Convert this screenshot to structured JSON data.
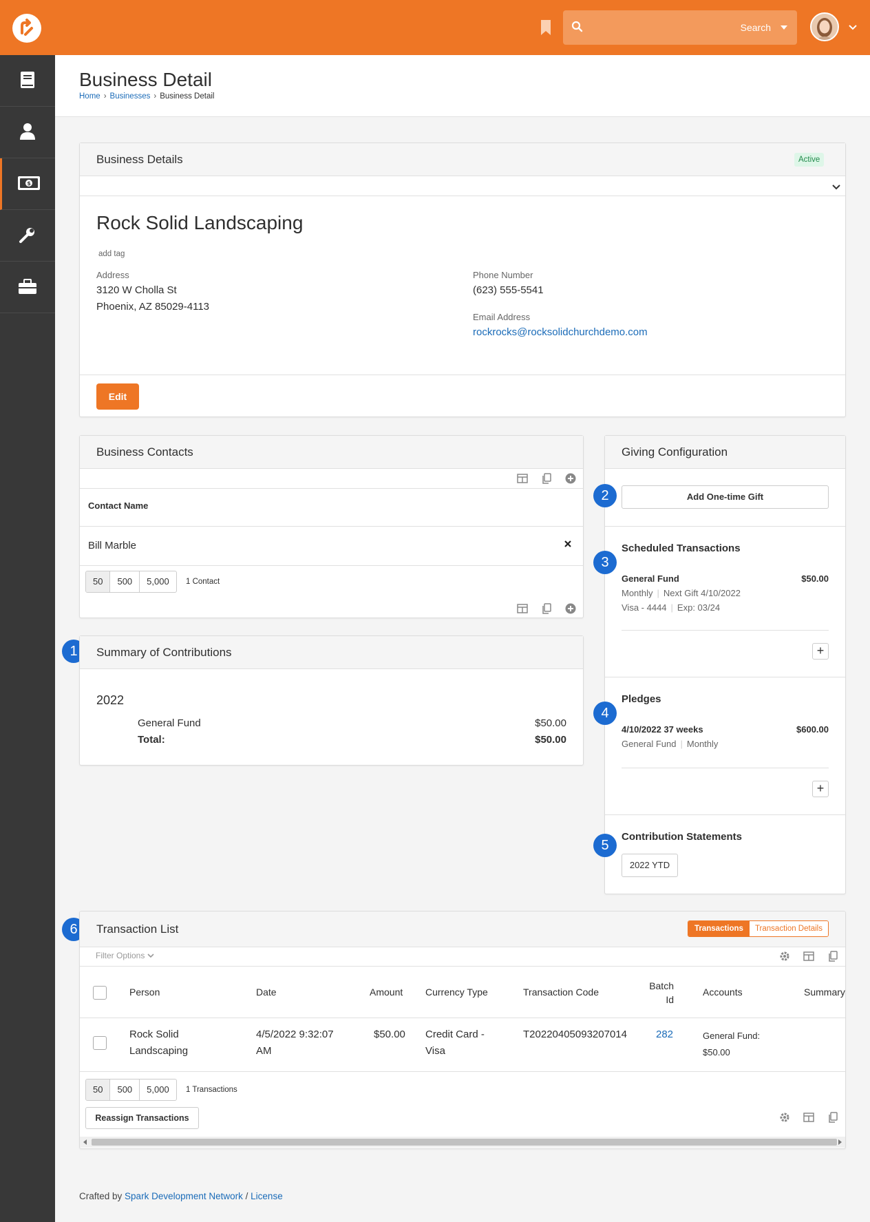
{
  "topbar": {
    "search_label": "Search",
    "colors": {
      "brand": "#ee7625",
      "link": "#1a6bb8",
      "sidebar": "#383838",
      "step": "#1c6bd1"
    }
  },
  "page": {
    "title": "Business Detail",
    "breadcrumb": [
      "Home",
      "Businesses",
      "Business Detail"
    ]
  },
  "details": {
    "panel_title": "Business Details",
    "status": "Active",
    "name": "Rock Solid Landscaping",
    "add_tag": "add tag",
    "address_label": "Address",
    "address_line1": "3120 W Cholla St",
    "address_line2": "Phoenix, AZ 85029-4113",
    "phone_label": "Phone Number",
    "phone": "(623) 555-5541",
    "email_label": "Email Address",
    "email": "rockrocks@rocksolidchurchdemo.com",
    "edit_label": "Edit"
  },
  "contacts": {
    "title": "Business Contacts",
    "column": "Contact Name",
    "rows": [
      "Bill Marble"
    ],
    "pager": [
      "50",
      "500",
      "5,000"
    ],
    "count": "1 Contact"
  },
  "summary": {
    "step": "1",
    "title": "Summary of Contributions",
    "year": "2022",
    "fund": "General Fund",
    "fund_amount": "$50.00",
    "total_label": "Total:",
    "total_amount": "$50.00"
  },
  "giving": {
    "title": "Giving Configuration",
    "step_gift": "2",
    "add_gift": "Add One-time Gift",
    "step_scheduled": "3",
    "scheduled_title": "Scheduled Transactions",
    "sched_fund": "General Fund",
    "sched_amount": "$50.00",
    "sched_freq": "Monthly",
    "sched_next": "Next Gift 4/10/2022",
    "sched_card": "Visa - 4444",
    "sched_exp": "Exp: 03/24",
    "step_pledges": "4",
    "pledges_title": "Pledges",
    "pledge_date": "4/10/2022 37 weeks",
    "pledge_amount": "$600.00",
    "pledge_fund": "General Fund",
    "pledge_freq": "Monthly",
    "step_statements": "5",
    "statements_title": "Contribution Statements",
    "statement_btn": "2022 YTD"
  },
  "transactions": {
    "step": "6",
    "title": "Transaction List",
    "toggle": [
      "Transactions",
      "Transaction Details"
    ],
    "filter": "Filter Options",
    "columns": [
      "Person",
      "Date",
      "Amount",
      "Currency Type",
      "Transaction Code",
      "Batch Id",
      "Accounts",
      "Summary"
    ],
    "row": {
      "person": "Rock Solid Landscaping",
      "date": "4/5/2022 9:32:07 AM",
      "amount": "$50.00",
      "currency": "Credit Card - Visa",
      "code": "T20220405093207014",
      "batch": "282",
      "accounts": "General Fund: $50.00"
    },
    "pager": [
      "50",
      "500",
      "5,000"
    ],
    "count": "1 Transactions",
    "reassign": "Reassign Transactions"
  },
  "footer": {
    "crafted": "Crafted by",
    "network": "Spark Development Network",
    "sep": "/",
    "license": "License"
  }
}
